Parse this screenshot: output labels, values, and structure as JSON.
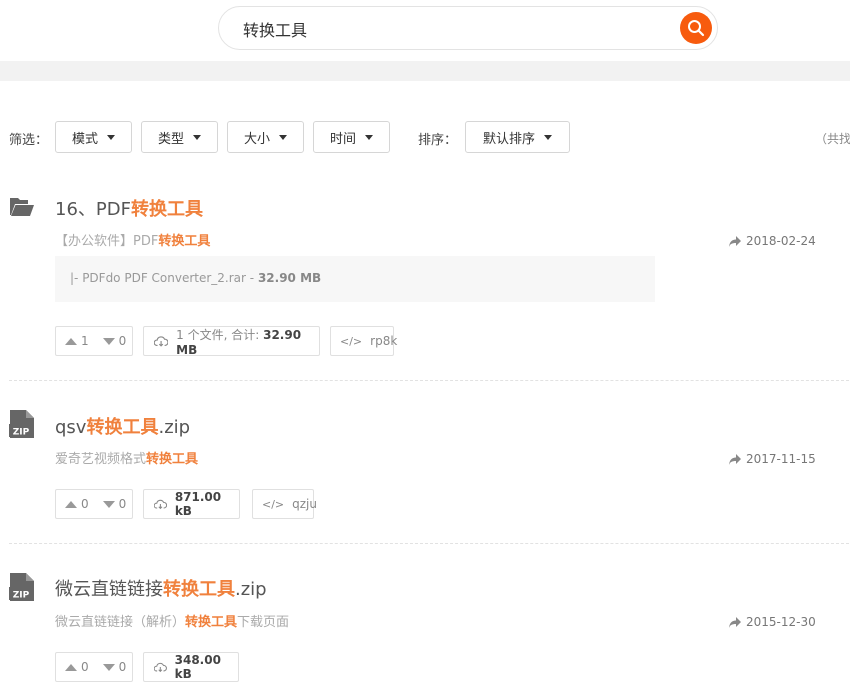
{
  "search": {
    "query": "转换工具"
  },
  "filters": {
    "label": "筛选：",
    "items": [
      "模式",
      "类型",
      "大小",
      "时间"
    ],
    "sort_label": "排序：",
    "sort_value": "默认排序",
    "total_text": "（共找"
  },
  "results": [
    {
      "icon": "folder-icon",
      "title_pre": "16、PDF",
      "title_hl": "转换工具",
      "title_post": "",
      "desc_pre": "【办公软件】PDF",
      "desc_hl": "转换工具",
      "desc_post": "",
      "date": "2018-02-24",
      "file_name": "|- PDFdo PDF Converter_2.rar - ",
      "file_size": "32.90 MB",
      "up": "1",
      "down": "0",
      "size_pre": "1 个文件, 合计: ",
      "size": "32.90 MB",
      "code": "rp8k"
    },
    {
      "icon": "zip-icon",
      "title_pre": "qsv",
      "title_hl": "转换工具",
      "title_post": ".zip",
      "desc_pre": "爱奇艺视频格式",
      "desc_hl": "转换工具",
      "desc_post": "",
      "date": "2017-11-15",
      "up": "0",
      "down": "0",
      "size_pre": "",
      "size": "871.00 kB",
      "code": "qzju"
    },
    {
      "icon": "zip-icon",
      "title_pre": "微云直链链接",
      "title_hl": "转换工具",
      "title_post": ".zip",
      "desc_pre": "微云直链链接（解析）",
      "desc_hl": "转换工具",
      "desc_post": "下载页面",
      "date": "2015-12-30",
      "up": "0",
      "down": "0",
      "size_pre": "",
      "size": "348.00 kB"
    }
  ],
  "zip_label": "ZIP",
  "colors": {
    "accent": "#f75b0e",
    "highlight": "#f0813d"
  }
}
